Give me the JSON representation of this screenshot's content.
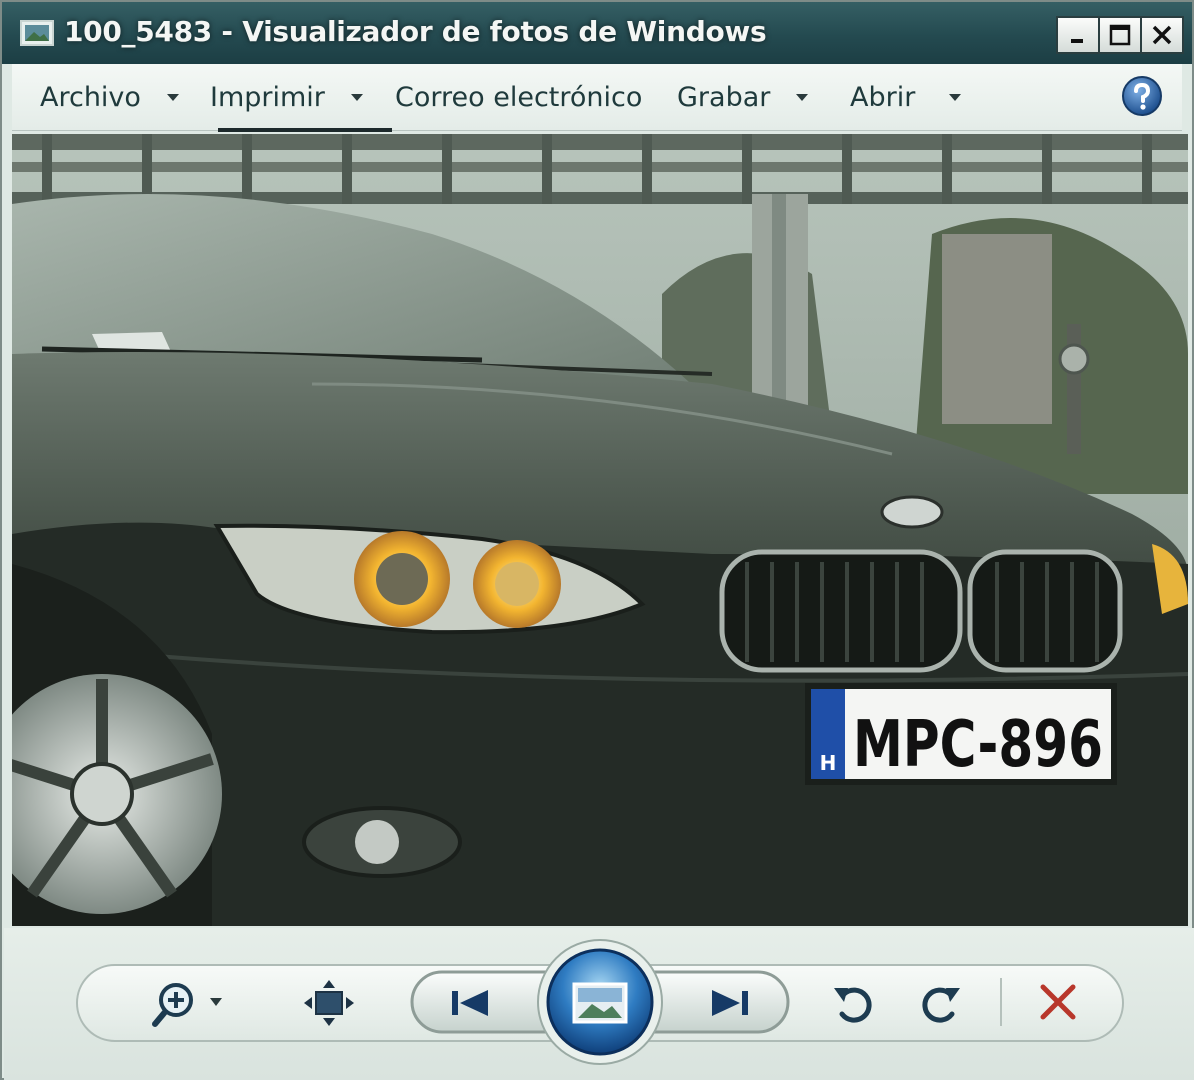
{
  "window": {
    "title": "100_5483 - Visualizador de fotos de Windows"
  },
  "menu": {
    "items": [
      {
        "label": "Archivo",
        "has_dropdown": true
      },
      {
        "label": "Imprimir",
        "has_dropdown": true
      },
      {
        "label": "Correo electrónico",
        "has_dropdown": false
      },
      {
        "label": "Grabar",
        "has_dropdown": true
      },
      {
        "label": "Abrir",
        "has_dropdown": true
      }
    ],
    "help_icon": "help-icon"
  },
  "photo": {
    "license_plate": "MPC-896",
    "plate_country": "H"
  },
  "toolbar": {
    "icons": [
      "zoom-icon",
      "fit-window-icon",
      "previous-icon",
      "slideshow-icon",
      "next-icon",
      "rotate-counterclockwise-icon",
      "rotate-clockwise-icon",
      "delete-icon"
    ]
  },
  "colors": {
    "titlebar": "#244a50",
    "delete_red": "#b8372b",
    "accent_blue": "#1d4f8e"
  }
}
